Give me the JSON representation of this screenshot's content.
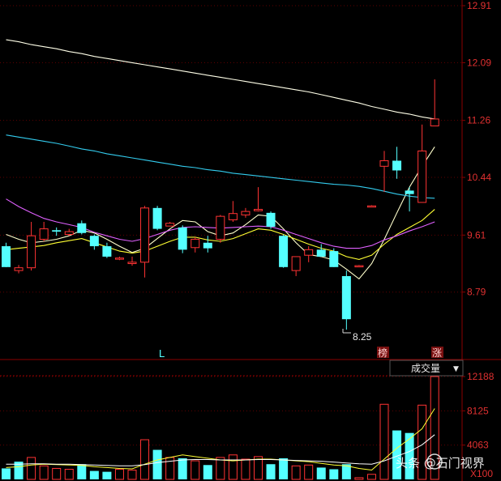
{
  "colors": {
    "up": "#ff3333",
    "down": "#54ffff",
    "ma_white": "#ffffcc",
    "ma_yellow": "#ffff33",
    "ma_magenta": "#e060ff",
    "ma_cyan": "#33ccee",
    "ma_cream": "#ffffe8",
    "grid": "#8b0000",
    "axis_text": "#e03030",
    "vol_ma_yellow": "#ffff33",
    "vol_ma_white": "#ffffff"
  },
  "markers": {
    "low_label": "8.25",
    "label_L": "L",
    "label_bang": "榜",
    "label_zhang": "涨",
    "volume_dropdown": "成交量",
    "dropdown_arrow": "▼",
    "vol_unit": "X100",
    "watermark": "头条 @石门视界"
  },
  "chart_data": [
    {
      "type": "candlestick",
      "y_ticks": [
        12.91,
        12.09,
        11.26,
        10.44,
        9.61,
        8.79
      ],
      "ylim": [
        7.82,
        12.91
      ],
      "candles": [
        {
          "o": 9.45,
          "h": 9.5,
          "l": 9.15,
          "c": 9.15
        },
        {
          "o": 9.1,
          "h": 9.18,
          "l": 9.06,
          "c": 9.14
        },
        {
          "o": 9.14,
          "h": 9.8,
          "l": 9.1,
          "c": 9.6
        },
        {
          "o": 9.55,
          "h": 9.8,
          "l": 9.52,
          "c": 9.7
        },
        {
          "o": 9.68,
          "h": 9.72,
          "l": 9.6,
          "c": 9.66
        },
        {
          "o": 9.62,
          "h": 9.7,
          "l": 9.6,
          "c": 9.66
        },
        {
          "o": 9.78,
          "h": 9.82,
          "l": 9.62,
          "c": 9.64
        },
        {
          "o": 9.6,
          "h": 9.62,
          "l": 9.4,
          "c": 9.45
        },
        {
          "o": 9.45,
          "h": 9.5,
          "l": 9.28,
          "c": 9.3
        },
        {
          "o": 9.27,
          "h": 9.3,
          "l": 9.25,
          "c": 9.28
        },
        {
          "o": 9.2,
          "h": 9.3,
          "l": 9.17,
          "c": 9.22
        },
        {
          "o": 9.22,
          "h": 10.03,
          "l": 9.0,
          "c": 10.0
        },
        {
          "o": 10.0,
          "h": 10.03,
          "l": 9.68,
          "c": 9.7
        },
        {
          "o": 9.74,
          "h": 9.8,
          "l": 9.74,
          "c": 9.78
        },
        {
          "o": 9.72,
          "h": 9.75,
          "l": 9.35,
          "c": 9.4
        },
        {
          "o": 9.43,
          "h": 9.58,
          "l": 9.36,
          "c": 9.55
        },
        {
          "o": 9.5,
          "h": 9.6,
          "l": 9.36,
          "c": 9.42
        },
        {
          "o": 9.55,
          "h": 9.9,
          "l": 9.5,
          "c": 9.88
        },
        {
          "o": 9.83,
          "h": 10.1,
          "l": 9.8,
          "c": 9.92
        },
        {
          "o": 9.9,
          "h": 10.0,
          "l": 9.86,
          "c": 9.95
        },
        {
          "o": 9.96,
          "h": 10.3,
          "l": 9.95,
          "c": 9.98
        },
        {
          "o": 9.93,
          "h": 9.95,
          "l": 9.7,
          "c": 9.73
        },
        {
          "o": 9.6,
          "h": 9.62,
          "l": 9.14,
          "c": 9.15
        },
        {
          "o": 9.1,
          "h": 9.3,
          "l": 9.02,
          "c": 9.3
        },
        {
          "o": 9.32,
          "h": 9.45,
          "l": 9.22,
          "c": 9.4
        },
        {
          "o": 9.4,
          "h": 9.48,
          "l": 9.3,
          "c": 9.3
        },
        {
          "o": 9.38,
          "h": 9.42,
          "l": 9.15,
          "c": 9.15
        },
        {
          "o": 9.02,
          "h": 9.1,
          "l": 8.25,
          "c": 8.4
        },
        {
          "o": 9.16,
          "h": 9.18,
          "l": 9.16,
          "c": 9.17
        },
        {
          "o": 10.02,
          "h": 10.04,
          "l": 10.02,
          "c": 10.03
        },
        {
          "o": 10.6,
          "h": 10.82,
          "l": 10.23,
          "c": 10.68
        },
        {
          "o": 10.68,
          "h": 10.88,
          "l": 10.42,
          "c": 10.54
        },
        {
          "o": 10.25,
          "h": 10.3,
          "l": 9.95,
          "c": 10.2
        },
        {
          "o": 10.08,
          "h": 11.2,
          "l": 10.08,
          "c": 10.82
        },
        {
          "o": 11.18,
          "h": 11.85,
          "l": 11.18,
          "c": 11.28
        }
      ],
      "ma_lines": [
        {
          "color_key": "ma_white",
          "values": [
            9.62,
            9.55,
            9.5,
            9.52,
            9.55,
            9.6,
            9.68,
            9.64,
            9.55,
            9.45,
            9.36,
            9.42,
            9.56,
            9.7,
            9.82,
            9.8,
            9.66,
            9.6,
            9.64,
            9.76,
            9.9,
            9.88,
            9.7,
            9.5,
            9.33,
            9.3,
            9.25,
            9.12,
            8.98,
            9.2,
            9.55,
            9.93,
            10.3,
            10.6,
            10.88
          ]
        },
        {
          "color_key": "ma_yellow",
          "values": [
            9.4,
            9.42,
            9.44,
            9.46,
            9.5,
            9.53,
            9.56,
            9.5,
            9.44,
            9.38,
            9.35,
            9.38,
            9.45,
            9.52,
            9.58,
            9.58,
            9.54,
            9.52,
            9.56,
            9.63,
            9.7,
            9.68,
            9.62,
            9.55,
            9.48,
            9.42,
            9.38,
            9.3,
            9.26,
            9.32,
            9.48,
            9.62,
            9.72,
            9.82,
            9.98
          ]
        },
        {
          "color_key": "ma_magenta",
          "values": [
            10.13,
            10.02,
            9.93,
            9.85,
            9.8,
            9.76,
            9.72,
            9.65,
            9.6,
            9.55,
            9.52,
            9.56,
            9.62,
            9.68,
            9.72,
            9.73,
            9.72,
            9.71,
            9.72,
            9.73,
            9.74,
            9.73,
            9.68,
            9.62,
            9.56,
            9.5,
            9.45,
            9.42,
            9.42,
            9.46,
            9.54,
            9.6,
            9.67,
            9.73,
            9.8
          ]
        },
        {
          "color_key": "ma_cyan",
          "values": [
            11.05,
            11.02,
            10.99,
            10.96,
            10.93,
            10.89,
            10.85,
            10.82,
            10.78,
            10.75,
            10.72,
            10.69,
            10.66,
            10.63,
            10.6,
            10.58,
            10.55,
            10.53,
            10.5,
            10.48,
            10.46,
            10.44,
            10.42,
            10.4,
            10.38,
            10.36,
            10.34,
            10.33,
            10.31,
            10.28,
            10.24,
            10.2,
            10.17,
            10.15,
            10.14
          ]
        },
        {
          "color_key": "ma_cream",
          "values": [
            12.42,
            12.39,
            12.35,
            12.32,
            12.29,
            12.25,
            12.22,
            12.18,
            12.15,
            12.12,
            12.09,
            12.06,
            12.03,
            12.0,
            11.97,
            11.94,
            11.91,
            11.88,
            11.85,
            11.82,
            11.79,
            11.76,
            11.73,
            11.7,
            11.67,
            11.63,
            11.59,
            11.55,
            11.51,
            11.46,
            11.42,
            11.38,
            11.35,
            11.31,
            11.28
          ]
        }
      ]
    },
    {
      "type": "bar",
      "title": "成交量",
      "y_ticks": [
        12188,
        8125,
        4063
      ],
      "ylim": [
        0,
        12188
      ],
      "volumes": [
        1300,
        2100,
        2600,
        1600,
        1300,
        1200,
        1800,
        1000,
        900,
        1200,
        1100,
        4700,
        3500,
        2600,
        2500,
        2200,
        1700,
        2600,
        2900,
        2400,
        2700,
        1800,
        2500,
        1600,
        1700,
        1400,
        1200,
        1800,
        200,
        600,
        8900,
        5800,
        5500,
        8800,
        12188
      ],
      "direction": [
        0,
        0,
        1,
        1,
        1,
        1,
        0,
        0,
        0,
        1,
        1,
        1,
        0,
        1,
        0,
        1,
        0,
        1,
        1,
        1,
        1,
        0,
        0,
        1,
        1,
        0,
        0,
        0,
        1,
        1,
        1,
        0,
        0,
        1,
        1
      ],
      "ma_lines": [
        {
          "color_key": "vol_ma_yellow",
          "values": [
            1400,
            1500,
            1700,
            1800,
            1750,
            1700,
            1650,
            1500,
            1400,
            1300,
            1250,
            1800,
            2300,
            2600,
            2900,
            2700,
            2500,
            2300,
            2200,
            2300,
            2400,
            2400,
            2300,
            2200,
            2100,
            1900,
            1700,
            1600,
            1300,
            1100,
            2400,
            3700,
            4800,
            6000,
            8400
          ]
        },
        {
          "color_key": "vol_ma_white",
          "values": [
            1800,
            1800,
            1850,
            1850,
            1800,
            1800,
            1750,
            1700,
            1650,
            1600,
            1600,
            1750,
            2000,
            2150,
            2300,
            2350,
            2350,
            2300,
            2300,
            2300,
            2350,
            2350,
            2300,
            2250,
            2200,
            2150,
            2050,
            1950,
            1850,
            1800,
            2200,
            2750,
            3300,
            4100,
            5300
          ]
        }
      ]
    }
  ]
}
